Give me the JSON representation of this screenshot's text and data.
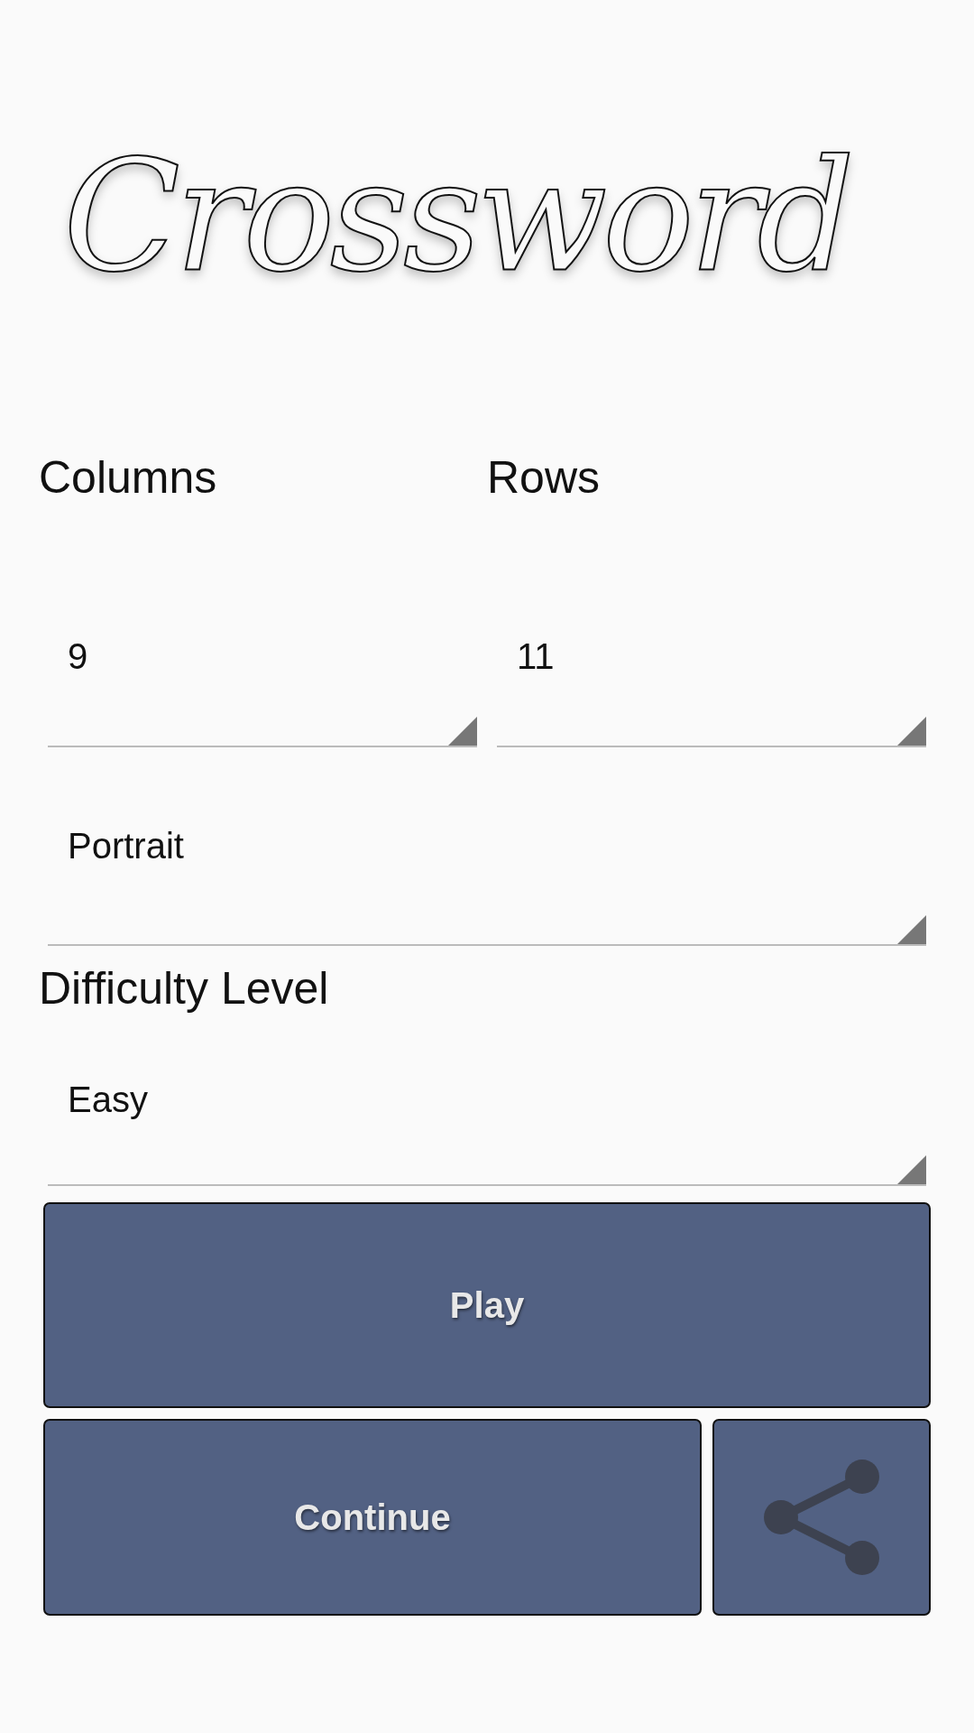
{
  "logo": {
    "title": "Crossword"
  },
  "size": {
    "columns_label": "Columns",
    "rows_label": "Rows",
    "columns_value": "9",
    "rows_value": "11"
  },
  "orientation": {
    "value": "Portrait"
  },
  "difficulty": {
    "label": "Difficulty Level",
    "value": "Easy"
  },
  "buttons": [
    {
      "kind": "text",
      "label": "Play"
    },
    {
      "kind": "text",
      "label": "Continue"
    },
    {
      "kind": "share"
    }
  ]
}
